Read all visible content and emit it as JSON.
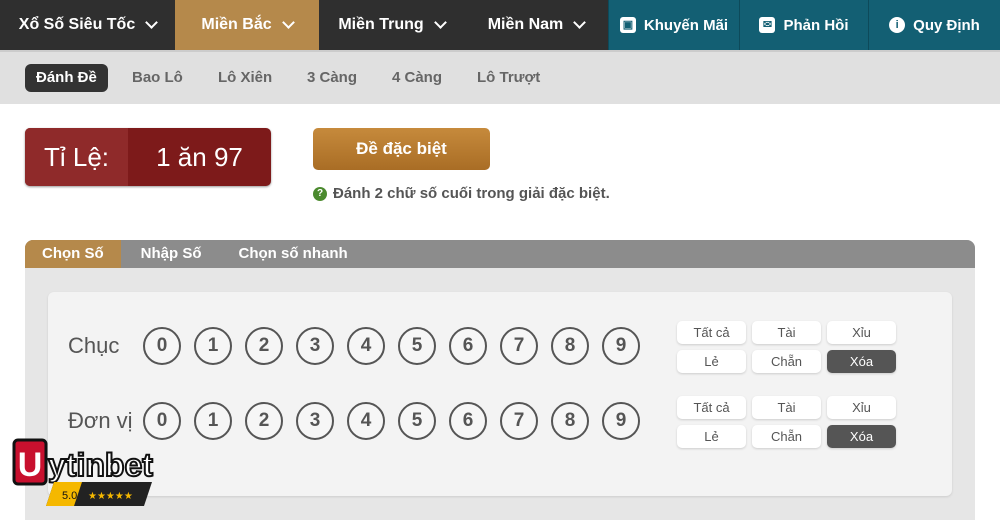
{
  "nav": {
    "items": [
      {
        "label": "Xổ Số Siêu Tốc",
        "dropdown": true
      },
      {
        "label": "Miền Bắc",
        "dropdown": true,
        "active": true
      },
      {
        "label": "Miền Trung",
        "dropdown": true
      },
      {
        "label": "Miền Nam",
        "dropdown": true
      },
      {
        "label": "Khuyến Mãi",
        "icon": "gift-icon"
      },
      {
        "label": "Phản Hồi",
        "icon": "feedback-icon"
      },
      {
        "label": "Quy Định",
        "icon": "info-icon"
      }
    ]
  },
  "subnav": {
    "items": [
      "Đánh Đề",
      "Bao Lô",
      "Lô Xiên",
      "3 Càng",
      "4 Càng",
      "Lô Trượt"
    ],
    "active": "Đánh Đề"
  },
  "ratio": {
    "label": "Tỉ Lệ:",
    "value": "1 ăn 97"
  },
  "bet_type_button": "Đề đặc biệt",
  "hint": "Đánh 2 chữ số cuối trong giải đặc biệt.",
  "tabs": {
    "items": [
      "Chọn Số",
      "Nhập Số",
      "Chọn số nhanh"
    ],
    "active": "Chọn Số"
  },
  "rows": [
    {
      "label": "Chục",
      "digits": [
        "0",
        "1",
        "2",
        "3",
        "4",
        "5",
        "6",
        "7",
        "8",
        "9"
      ],
      "quick": [
        "Tất cả",
        "Tài",
        "Xỉu",
        "Lẻ",
        "Chẵn",
        "Xóa"
      ]
    },
    {
      "label": "Đơn vị",
      "digits": [
        "0",
        "1",
        "2",
        "3",
        "4",
        "5",
        "6",
        "7",
        "8",
        "9"
      ],
      "quick": [
        "Tất cả",
        "Tài",
        "Xỉu",
        "Lẻ",
        "Chẵn",
        "Xóa"
      ]
    }
  ],
  "watermark": {
    "text": "Uytinbet",
    "rating": "5.0"
  },
  "colors": {
    "accent": "#b5894b",
    "teal": "#135f73",
    "ratio": "#7d1a1a"
  }
}
